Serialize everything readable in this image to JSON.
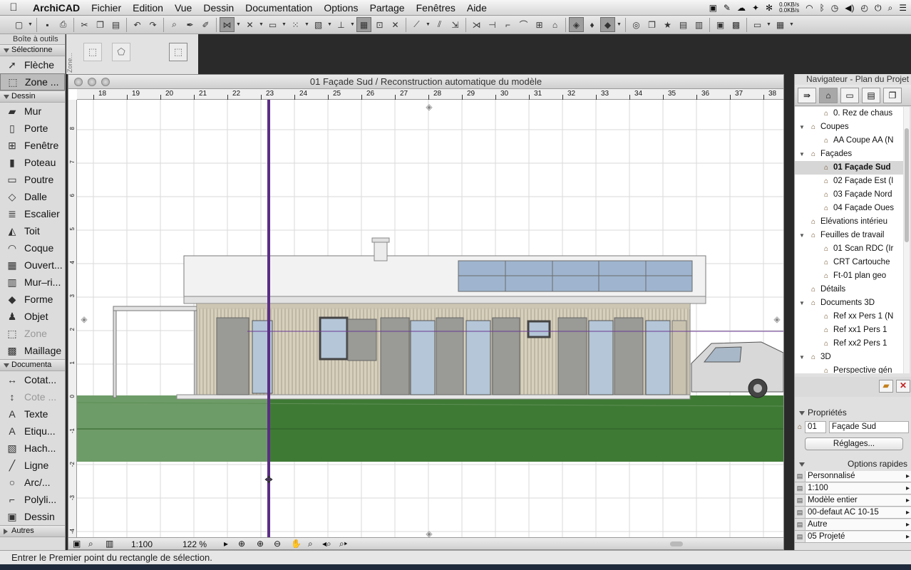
{
  "menubar": {
    "app": "ArchiCAD",
    "items": [
      "Fichier",
      "Edition",
      "Vue",
      "Dessin",
      "Documentation",
      "Options",
      "Partage",
      "Fenêtres",
      "Aide"
    ],
    "net_up": "0.0KB/s",
    "net_down": "0.0KB/s"
  },
  "toolbox": {
    "title": "Boîte à outils",
    "select_header": "Sélectionne",
    "tools_select": [
      {
        "label": "Flèche",
        "icon": "arrow-icon",
        "glyph": "➚"
      },
      {
        "label": "Zone ...",
        "icon": "marquee-icon",
        "glyph": "⬚",
        "selected": true
      }
    ],
    "dessin_header": "Dessin",
    "tools_dessin": [
      {
        "label": "Mur",
        "icon": "wall-icon",
        "glyph": "▰"
      },
      {
        "label": "Porte",
        "icon": "door-icon",
        "glyph": "▯"
      },
      {
        "label": "Fenêtre",
        "icon": "window-icon",
        "glyph": "⊞"
      },
      {
        "label": "Poteau",
        "icon": "column-icon",
        "glyph": "▮"
      },
      {
        "label": "Poutre",
        "icon": "beam-icon",
        "glyph": "▭"
      },
      {
        "label": "Dalle",
        "icon": "slab-icon",
        "glyph": "◇"
      },
      {
        "label": "Escalier",
        "icon": "stair-icon",
        "glyph": "≣"
      },
      {
        "label": "Toit",
        "icon": "roof-icon",
        "glyph": "◭"
      },
      {
        "label": "Coque",
        "icon": "shell-icon",
        "glyph": "◠"
      },
      {
        "label": "Ouvert...",
        "icon": "opening-icon",
        "glyph": "▦"
      },
      {
        "label": "Mur–ri...",
        "icon": "curtain-wall-icon",
        "glyph": "▥"
      },
      {
        "label": "Forme",
        "icon": "morph-icon",
        "glyph": "◆"
      },
      {
        "label": "Objet",
        "icon": "object-icon",
        "glyph": "♟"
      },
      {
        "label": "Zone",
        "icon": "zone-icon",
        "glyph": "⬚",
        "dim": true
      },
      {
        "label": "Maillage",
        "icon": "mesh-icon",
        "glyph": "▩"
      }
    ],
    "doc_header": "Documenta",
    "tools_doc": [
      {
        "label": "Cotat...",
        "icon": "dimension-icon",
        "glyph": "↔"
      },
      {
        "label": "Cote ...",
        "icon": "level-dimension-icon",
        "glyph": "↕",
        "dim": true
      },
      {
        "label": "Texte",
        "icon": "text-icon",
        "glyph": "A"
      },
      {
        "label": "Etiqu...",
        "icon": "label-icon",
        "glyph": "A"
      },
      {
        "label": "Hach...",
        "icon": "fill-icon",
        "glyph": "▧"
      },
      {
        "label": "Ligne",
        "icon": "line-icon",
        "glyph": "╱"
      },
      {
        "label": "Arc/...",
        "icon": "arc-icon",
        "glyph": "○"
      },
      {
        "label": "Polyli...",
        "icon": "polyline-icon",
        "glyph": "⌐"
      },
      {
        "label": "Dessin",
        "icon": "drawing-icon",
        "glyph": "▣"
      }
    ],
    "autres_header": "Autres"
  },
  "infobox": {
    "label": "Zone..."
  },
  "window": {
    "title": "01 Façade Sud / Reconstruction automatique du modèle",
    "scale": "1:100",
    "zoom": "122 %"
  },
  "ruler": {
    "top": [
      "18",
      "19",
      "20",
      "21",
      "22",
      "23",
      "24",
      "25",
      "26",
      "27",
      "28",
      "29",
      "30",
      "31",
      "32",
      "33",
      "34",
      "35",
      "36",
      "37",
      "38"
    ],
    "left": [
      "8",
      "7",
      "6",
      "5",
      "4",
      "3",
      "2",
      "1",
      "0",
      "-1",
      "-2",
      "-3",
      "-4"
    ]
  },
  "navigator": {
    "title": "Navigateur - Plan du Projet",
    "tree": [
      {
        "label": "0. Rez de chaus",
        "level": 2,
        "icon": "story-icon"
      },
      {
        "label": "Coupes",
        "level": 1,
        "icon": "section-folder-icon",
        "open": true
      },
      {
        "label": "AA Coupe AA (N",
        "level": 2,
        "icon": "section-icon"
      },
      {
        "label": "Façades",
        "level": 1,
        "icon": "elevation-folder-icon",
        "open": true
      },
      {
        "label": "01 Façade Sud",
        "level": 2,
        "icon": "elevation-icon",
        "selected": true
      },
      {
        "label": "02 Façade Est (I",
        "level": 2,
        "icon": "elevation-icon"
      },
      {
        "label": "03 Façade Nord",
        "level": 2,
        "icon": "elevation-icon"
      },
      {
        "label": "04 Façade Oues",
        "level": 2,
        "icon": "elevation-icon"
      },
      {
        "label": "Elévations intérieu",
        "level": 1,
        "icon": "interior-elevation-icon"
      },
      {
        "label": "Feuilles de travail",
        "level": 1,
        "icon": "worksheet-folder-icon",
        "open": true
      },
      {
        "label": "01 Scan RDC (Ir",
        "level": 2,
        "icon": "worksheet-icon"
      },
      {
        "label": "CRT Cartouche",
        "level": 2,
        "icon": "worksheet-icon"
      },
      {
        "label": "Ft-01 plan geo",
        "level": 2,
        "icon": "worksheet-icon"
      },
      {
        "label": "Détails",
        "level": 1,
        "icon": "detail-icon"
      },
      {
        "label": "Documents 3D",
        "level": 1,
        "icon": "doc3d-folder-icon",
        "open": true
      },
      {
        "label": "Ref xx Pers 1 (N",
        "level": 2,
        "icon": "doc3d-icon"
      },
      {
        "label": "Ref xx1 Pers 1",
        "level": 2,
        "icon": "doc3d-icon"
      },
      {
        "label": "Ref xx2 Pers 1",
        "level": 2,
        "icon": "doc3d-icon"
      },
      {
        "label": "3D",
        "level": 1,
        "icon": "3d-folder-icon",
        "open": true
      },
      {
        "label": "Perspective gén",
        "level": 2,
        "icon": "perspective-icon"
      }
    ],
    "props_header": "Propriétés",
    "props_id": "01",
    "props_name": "Façade Sud",
    "settings_button": "Réglages...",
    "quick_header": "Options rapides",
    "quick": [
      {
        "icon": "layer-combo-icon",
        "value": "Personnalisé"
      },
      {
        "icon": "scale-icon",
        "value": "1:100"
      },
      {
        "icon": "model-view-icon",
        "value": "Modèle entier"
      },
      {
        "icon": "pen-set-icon",
        "value": "00-defaut AC 10-15"
      },
      {
        "icon": "dimension-std-icon",
        "value": "Autre"
      },
      {
        "icon": "renovation-icon",
        "value": "05 Projeté"
      }
    ]
  },
  "status": "Entrer le Premier point du rectangle de sélection.",
  "colors": {
    "grass_light": "#6e9c68",
    "grass": "#3f7a35",
    "guide_line": "#5b2d86",
    "glass": "#9fb5cf",
    "siding": "#d7d0bd"
  }
}
